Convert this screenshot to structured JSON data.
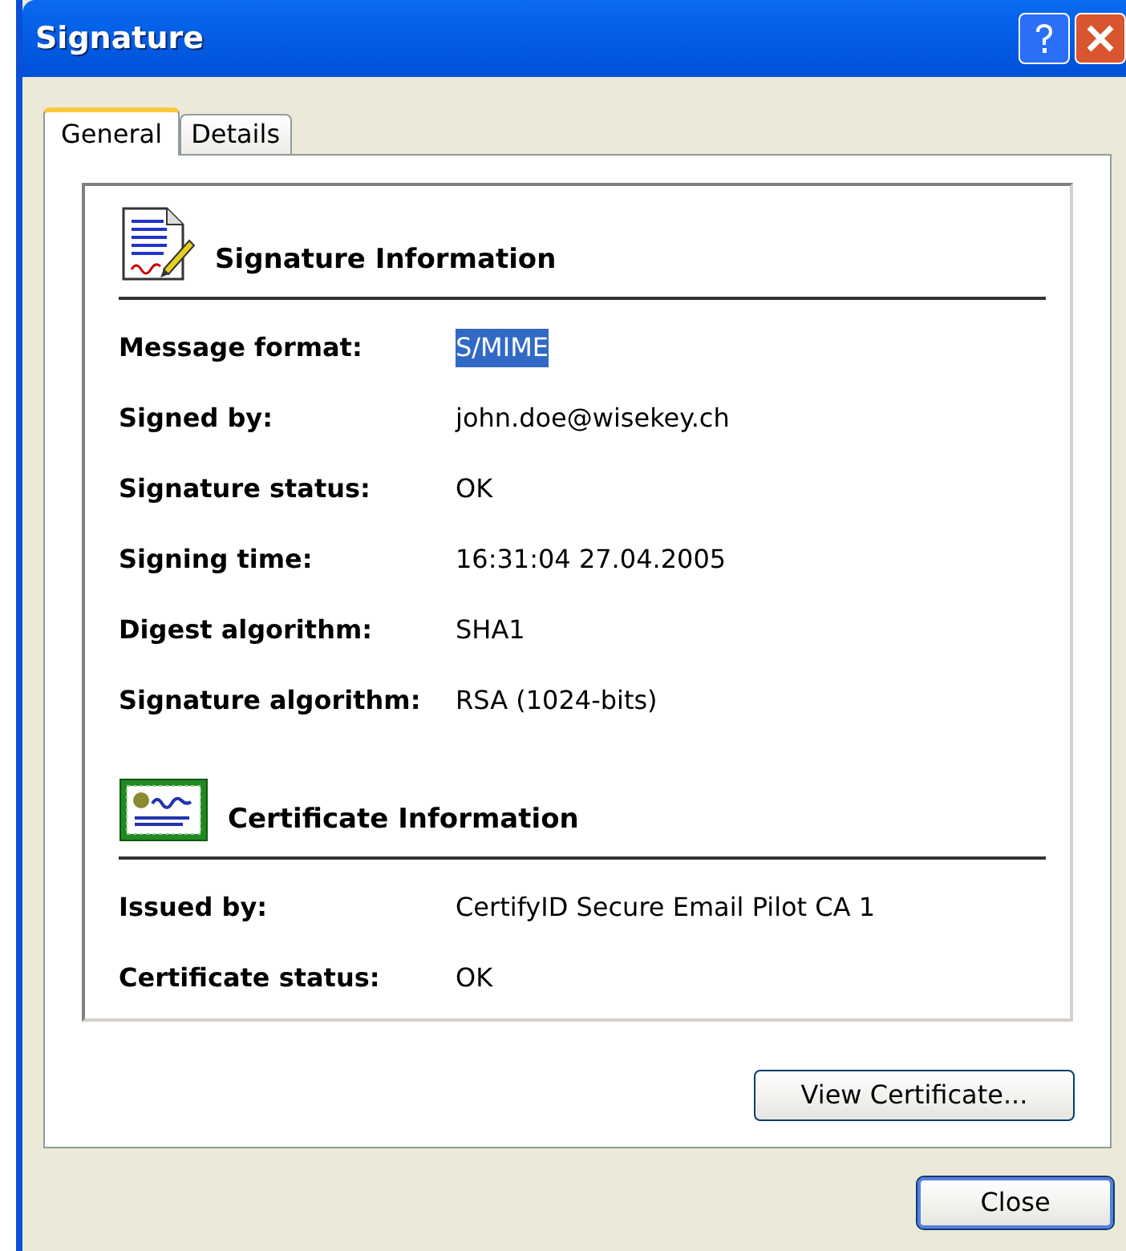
{
  "window": {
    "title": "Signature"
  },
  "tabs": [
    {
      "label": "General",
      "selected": true
    },
    {
      "label": "Details",
      "selected": false
    }
  ],
  "sections": [
    {
      "kind": "signature",
      "title": "Signature Information",
      "fields": [
        {
          "label": "Message format:",
          "value": "S/MIME",
          "selected": true
        },
        {
          "label": "Signed by:",
          "value": "john.doe@wisekey.ch",
          "selected": false
        },
        {
          "label": "Signature status:",
          "value": "OK",
          "selected": false
        },
        {
          "label": "Signing time:",
          "value": "16:31:04 27.04.2005",
          "selected": false
        },
        {
          "label": "Digest algorithm:",
          "value": "SHA1",
          "selected": false
        },
        {
          "label": "Signature algorithm:",
          "value": "RSA (1024-bits)",
          "selected": false
        }
      ]
    },
    {
      "kind": "certificate",
      "title": "Certificate Information",
      "fields": [
        {
          "label": "Issued by:",
          "value": "CertifyID Secure Email Pilot CA 1",
          "selected": false
        },
        {
          "label": "Certificate status:",
          "value": "OK",
          "selected": false
        }
      ]
    }
  ],
  "view_button": "View Certificate...",
  "close_button": "Close"
}
